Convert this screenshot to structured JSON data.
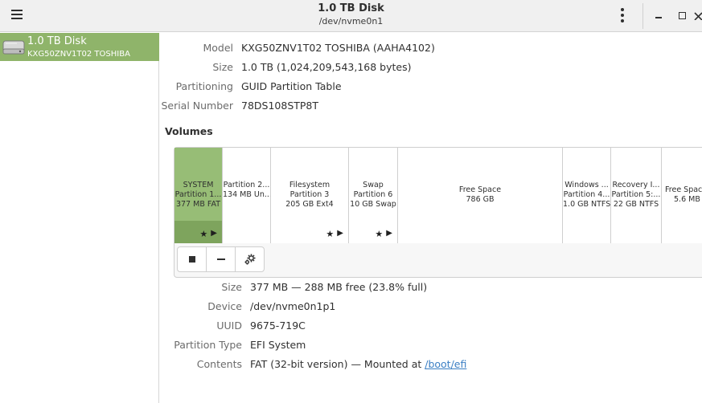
{
  "header": {
    "title": "1.0 TB Disk",
    "subtitle": "/dev/nvme0n1"
  },
  "sidebar": {
    "items": [
      {
        "name": "1.0 TB Disk",
        "model": "KXG50ZNV1T02 TOSHIBA",
        "icon": "hard-drive-icon",
        "selected": true
      }
    ]
  },
  "drive": {
    "properties": [
      {
        "label": "Model",
        "value": "KXG50ZNV1T02 TOSHIBA (AAHA4102)"
      },
      {
        "label": "Size",
        "value": "1.0 TB (1,024,209,543,168 bytes)"
      },
      {
        "label": "Partitioning",
        "value": "GUID Partition Table"
      },
      {
        "label": "Serial Number",
        "value": "78DS108STP8T"
      }
    ]
  },
  "volumes": {
    "heading": "Volumes",
    "partitions": [
      {
        "line1": "SYSTEM",
        "line2": "Partition 1...",
        "line3": "377 MB FAT",
        "selected": true,
        "mounted": true
      },
      {
        "line1": "Partition 2...",
        "line2": "134 MB Un...",
        "line3": "",
        "selected": false,
        "mounted": false
      },
      {
        "line1": "Filesystem",
        "line2": "Partition 3",
        "line3": "205 GB Ext4",
        "selected": false,
        "mounted": true
      },
      {
        "line1": "Swap",
        "line2": "Partition 6",
        "line3": "10 GB Swap",
        "selected": false,
        "mounted": true
      },
      {
        "line1": "Free Space",
        "line2": "786 GB",
        "line3": "",
        "selected": false,
        "mounted": false
      },
      {
        "line1": "Windows ...",
        "line2": "Partition 4...",
        "line3": "1.0 GB NTFS",
        "selected": false,
        "mounted": false
      },
      {
        "line1": "Recovery I...",
        "line2": "Partition 5:...",
        "line3": "22 GB NTFS",
        "selected": false,
        "mounted": false
      },
      {
        "line1": "Free Spac",
        "line2": "5.6 MB",
        "line3": "",
        "selected": false,
        "mounted": false
      }
    ],
    "toolbar": {
      "buttons": [
        {
          "name": "unmount-button",
          "icon": "stop-icon"
        },
        {
          "name": "delete-partition-button",
          "icon": "minus-icon"
        },
        {
          "name": "partition-options-button",
          "icon": "gears-icon"
        }
      ]
    }
  },
  "selected_volume": {
    "properties": [
      {
        "label": "Size",
        "value": "377 MB — 288 MB free (23.8% full)"
      },
      {
        "label": "Device",
        "value": "/dev/nvme0n1p1"
      },
      {
        "label": "UUID",
        "value": "9675-719C"
      },
      {
        "label": "Partition Type",
        "value": "EFI System"
      }
    ],
    "contents": {
      "label": "Contents",
      "text": "FAT (32-bit version) — Mounted at ",
      "link": "/boot/efi"
    }
  }
}
